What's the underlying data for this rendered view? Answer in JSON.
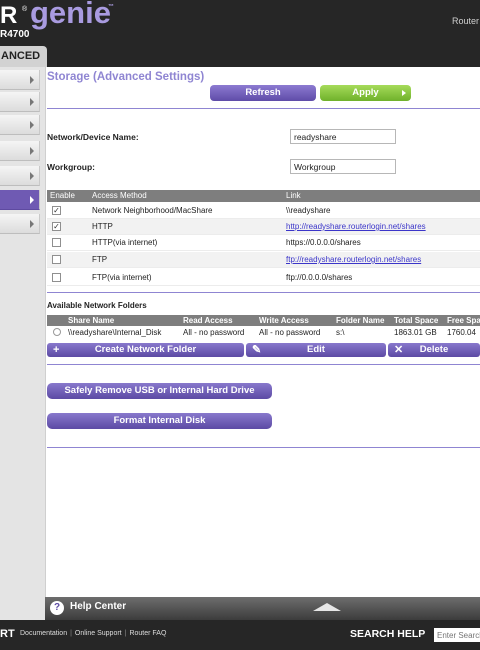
{
  "header": {
    "brand_letter": "R",
    "brand_reg": "®",
    "brand_name": "genie",
    "brand_tm": "™",
    "model": "R4700",
    "router_label": "Router",
    "advanced_tab": "ANCED"
  },
  "sidebar": {
    "item_count": 8,
    "active_index": 5
  },
  "page": {
    "title": "Storage (Advanced Settings)",
    "refresh_label": "Refresh",
    "apply_label": "Apply"
  },
  "form": {
    "device_name_label": "Network/Device Name:",
    "device_name_value": "readyshare",
    "workgroup_label": "Workgroup:",
    "workgroup_value": "Workgroup"
  },
  "access_table": {
    "headers": {
      "enable": "Enable",
      "method": "Access Method",
      "link": "Link"
    },
    "rows": [
      {
        "checked": true,
        "mark": "✓",
        "method": "Network Neighborhood/MacShare",
        "link": "\\\\readyshare"
      },
      {
        "checked": true,
        "mark": "✓",
        "method": "HTTP",
        "link": "http://readyshare.routerlogin.net/shares"
      },
      {
        "checked": false,
        "mark": "",
        "method": "HTTP(via internet)",
        "link": "https://0.0.0.0/shares"
      },
      {
        "checked": false,
        "mark": "",
        "method": "FTP",
        "link": "ftp://readyshare.routerlogin.net/shares"
      },
      {
        "checked": false,
        "mark": "",
        "method": "FTP(via internet)",
        "link": "ftp://0.0.0.0/shares"
      }
    ]
  },
  "folders": {
    "title": "Available Network Folders",
    "headers": {
      "share_name": "Share Name",
      "read_access": "Read Access",
      "write_access": "Write Access",
      "folder_name": "Folder Name",
      "total_space": "Total Space",
      "free_space": "Free Spa"
    },
    "row": {
      "share_name": "\\\\readyshare\\Internal_Disk",
      "read_access": "All - no password",
      "write_access": "All - no password",
      "folder_name": "s:\\",
      "total_space": "1863.01 GB",
      "free_space": "1760.04"
    },
    "create_label": "Create Network Folder",
    "edit_label": "Edit",
    "delete_label": "Delete",
    "create_icon": "+",
    "edit_icon": "✎",
    "delete_icon": "✕"
  },
  "actions": {
    "remove_usb_label": "Safely Remove USB or Internal Hard Drive",
    "format_label": "Format Internal Disk"
  },
  "helpbar": {
    "q": "?",
    "label": "Help Center"
  },
  "footer": {
    "rt": "RT",
    "links": [
      "Documentation",
      "Online Support",
      "Router FAQ"
    ],
    "sep": "|",
    "search_help": "SEARCH HELP",
    "search_placeholder": "Enter Search"
  },
  "colors": {
    "brand_purple": "#a99be0",
    "accent_purple": "#5c4aa4",
    "apply_green": "#6fb12b",
    "dark_bar": "#262626"
  }
}
